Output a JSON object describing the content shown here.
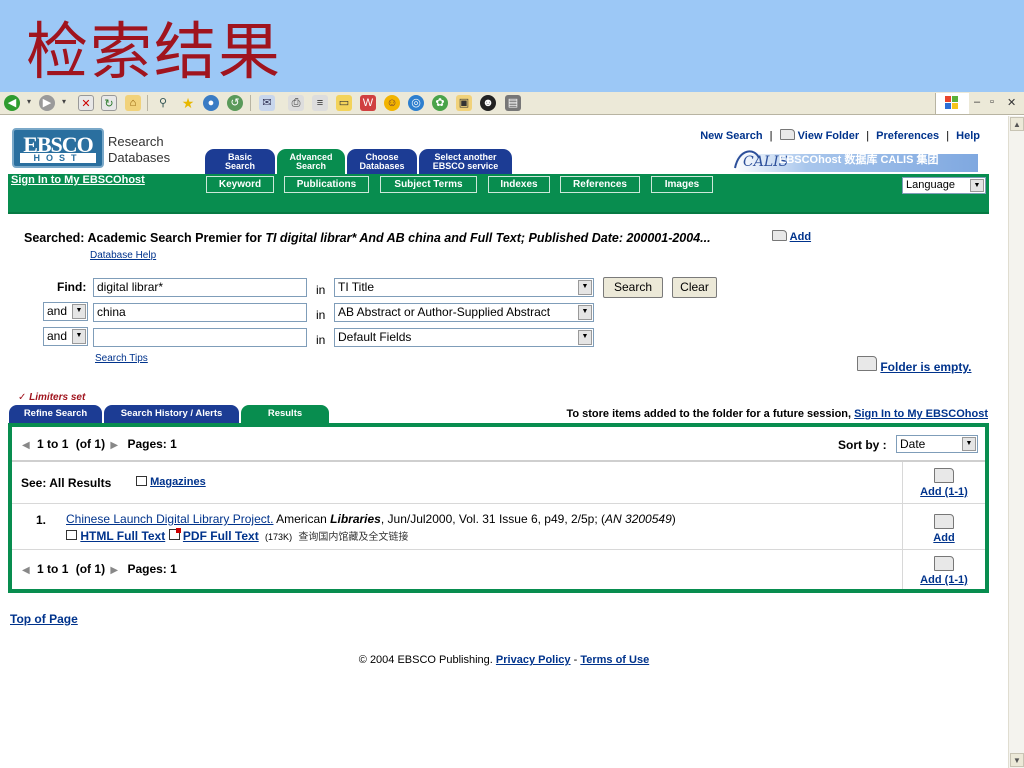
{
  "slide_title": "检索结果",
  "browser": {
    "toolbar_icons": [
      "back-icon",
      "forward-icon",
      "stop-icon",
      "refresh-icon",
      "home-icon",
      "search-icon",
      "favorites-icon",
      "media-icon",
      "history-icon",
      "mail-icon",
      "print-icon",
      "edit-icon",
      "discuss-icon",
      "messenger-icon",
      "smile-icon",
      "globe-icon",
      "research-icon",
      "tools-icon",
      "qq-icon",
      "page-icon"
    ],
    "window_controls": [
      "–",
      "▫",
      "✕"
    ]
  },
  "header": {
    "logo_main": "EBSCO",
    "logo_sub": "HOST",
    "logo_caption_1": "Research",
    "logo_caption_2": "Databases",
    "tabs": [
      {
        "line1": "Basic",
        "line2": "Search"
      },
      {
        "line1": "Advanced",
        "line2": "Search"
      },
      {
        "line1": "Choose",
        "line2": "Databases"
      },
      {
        "line1": "Select another",
        "line2": "EBSCO service"
      }
    ],
    "links": {
      "new_search": "New Search",
      "view_folder": "View Folder",
      "preferences": "Preferences",
      "help": "Help",
      "sep": "|"
    },
    "banner_text": "EBSCOhost 数据库 CALIS 集团",
    "banner_logo": "CALIS"
  },
  "green_bar": {
    "signin": "Sign In to My EBSCOhost",
    "subtabs": [
      "Keyword",
      "Publications",
      "Subject Terms",
      "Indexes",
      "References",
      "Images"
    ],
    "language": "Language"
  },
  "search": {
    "searched_label": "Searched:",
    "searched_text": "Academic Search Premier for",
    "searched_query": "TI digital librar* And AB china and Full Text; Published Date: 200001-2004...",
    "add_link": "Add",
    "database_help": "Database Help",
    "find_label": "Find:",
    "in_label": "in",
    "rows": [
      {
        "bool": "",
        "term": "digital librar*",
        "field": "TI Title"
      },
      {
        "bool": "and",
        "term": "china",
        "field": "AB Abstract or Author-Supplied Abstract"
      },
      {
        "bool": "and",
        "term": "",
        "field": "Default Fields"
      }
    ],
    "search_button": "Search",
    "clear_button": "Clear",
    "search_tips": "Search Tips",
    "folder_empty": "Folder is empty.",
    "limiters": "✓ Limiters set"
  },
  "result_tabs": [
    "Refine Search",
    "Search History / Alerts",
    "Results"
  ],
  "store_note": "To store items added to the folder for a future session,",
  "store_link": "Sign In to My EBSCOhost",
  "results": {
    "pager_range": "1 to 1",
    "pager_of": "(of 1)",
    "pages_label": "Pages: 1",
    "sort_label": "Sort by :",
    "sort_value": "Date",
    "see_label": "See: All Results",
    "magazines": "Magazines",
    "add_all": "Add (1-1)",
    "item": {
      "number": "1.",
      "title": "Chinese Launch Digital Library Project.",
      "source_pre": "American",
      "source_em": "Libraries",
      "source_post": ", Jun/Jul2000, Vol. 31 Issue 6, p49, 2/5p; (",
      "an": "AN 3200549",
      "source_end": ")",
      "html_full": "HTML Full Text",
      "pdf_full": "PDF Full Text",
      "pdf_size": "(173K)",
      "chinese_note": "查询国内馆藏及全文链接",
      "add": "Add"
    }
  },
  "footer": {
    "top_of_page": "Top of Page",
    "copyright": "© 2004 EBSCO Publishing.",
    "privacy": "Privacy Policy",
    "dash": "-",
    "terms": "Terms of Use"
  }
}
